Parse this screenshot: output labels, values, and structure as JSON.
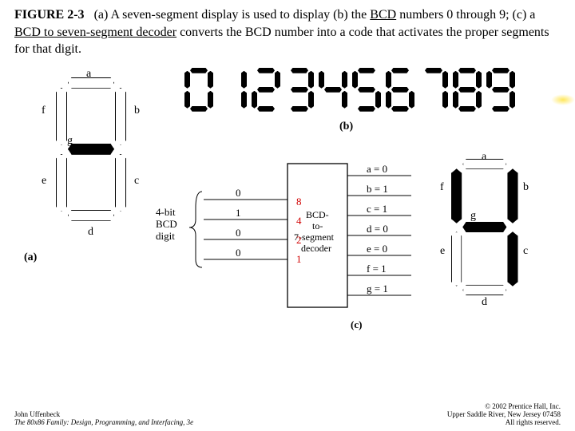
{
  "caption": {
    "fignum": "FIGURE 2-3",
    "p1a": "(a) A seven-segment display is used to display (b) the ",
    "p1u1": "BCD",
    "p1b": " numbers 0 through 9; (c) a ",
    "p1u2": "BCD to seven-segment decoder",
    "p1c": " converts the BCD number into a code that activates the proper segments for that digit."
  },
  "panelA": {
    "labels": {
      "a": "a",
      "b": "b",
      "c": "c",
      "d": "d",
      "e": "e",
      "f": "f",
      "g": "g"
    },
    "tag": "(a)"
  },
  "panelB": {
    "tag": "(b)",
    "digits": [
      {
        "char": "0",
        "on": [
          "a",
          "b",
          "c",
          "d",
          "e",
          "f"
        ]
      },
      {
        "char": "1",
        "on": [
          "b",
          "c"
        ]
      },
      {
        "char": "2",
        "on": [
          "a",
          "b",
          "g",
          "e",
          "d"
        ]
      },
      {
        "char": "3",
        "on": [
          "a",
          "b",
          "g",
          "c",
          "d"
        ]
      },
      {
        "char": "4",
        "on": [
          "f",
          "g",
          "b",
          "c"
        ]
      },
      {
        "char": "5",
        "on": [
          "a",
          "f",
          "g",
          "c",
          "d"
        ]
      },
      {
        "char": "6",
        "on": [
          "a",
          "f",
          "g",
          "c",
          "d",
          "e"
        ]
      },
      {
        "char": "7",
        "on": [
          "a",
          "b",
          "c"
        ]
      },
      {
        "char": "8",
        "on": [
          "a",
          "b",
          "c",
          "d",
          "e",
          "f",
          "g"
        ]
      },
      {
        "char": "9",
        "on": [
          "a",
          "b",
          "c",
          "d",
          "f",
          "g"
        ]
      }
    ]
  },
  "panelC": {
    "inputLabel": "4-bit\nBCD\ndigit",
    "inputBits": [
      "0",
      "1",
      "0",
      "0"
    ],
    "weights": [
      "8",
      "4",
      "2",
      "1"
    ],
    "decoderText1": "BCD-",
    "decoderText2": "to-",
    "decoderText3": "7-segment",
    "decoderText4": "decoder",
    "outputs": [
      {
        "name": "a",
        "val": "0"
      },
      {
        "name": "b",
        "val": "1"
      },
      {
        "name": "c",
        "val": "1"
      },
      {
        "name": "d",
        "val": "0"
      },
      {
        "name": "e",
        "val": "0"
      },
      {
        "name": "f",
        "val": "1"
      },
      {
        "name": "g",
        "val": "1"
      }
    ],
    "displaySegmentsOn": [
      "b",
      "c",
      "f",
      "g"
    ],
    "tag": "(c)"
  },
  "footer": {
    "author": "John Uffenbeck",
    "book": "The 80x86 Family: Design, Programming, and Interfacing, 3e",
    "pub1": "© 2002 Prentice Hall, Inc.",
    "pub2": "Upper Saddle River, New Jersey 07458",
    "pub3": "All rights reserved."
  }
}
